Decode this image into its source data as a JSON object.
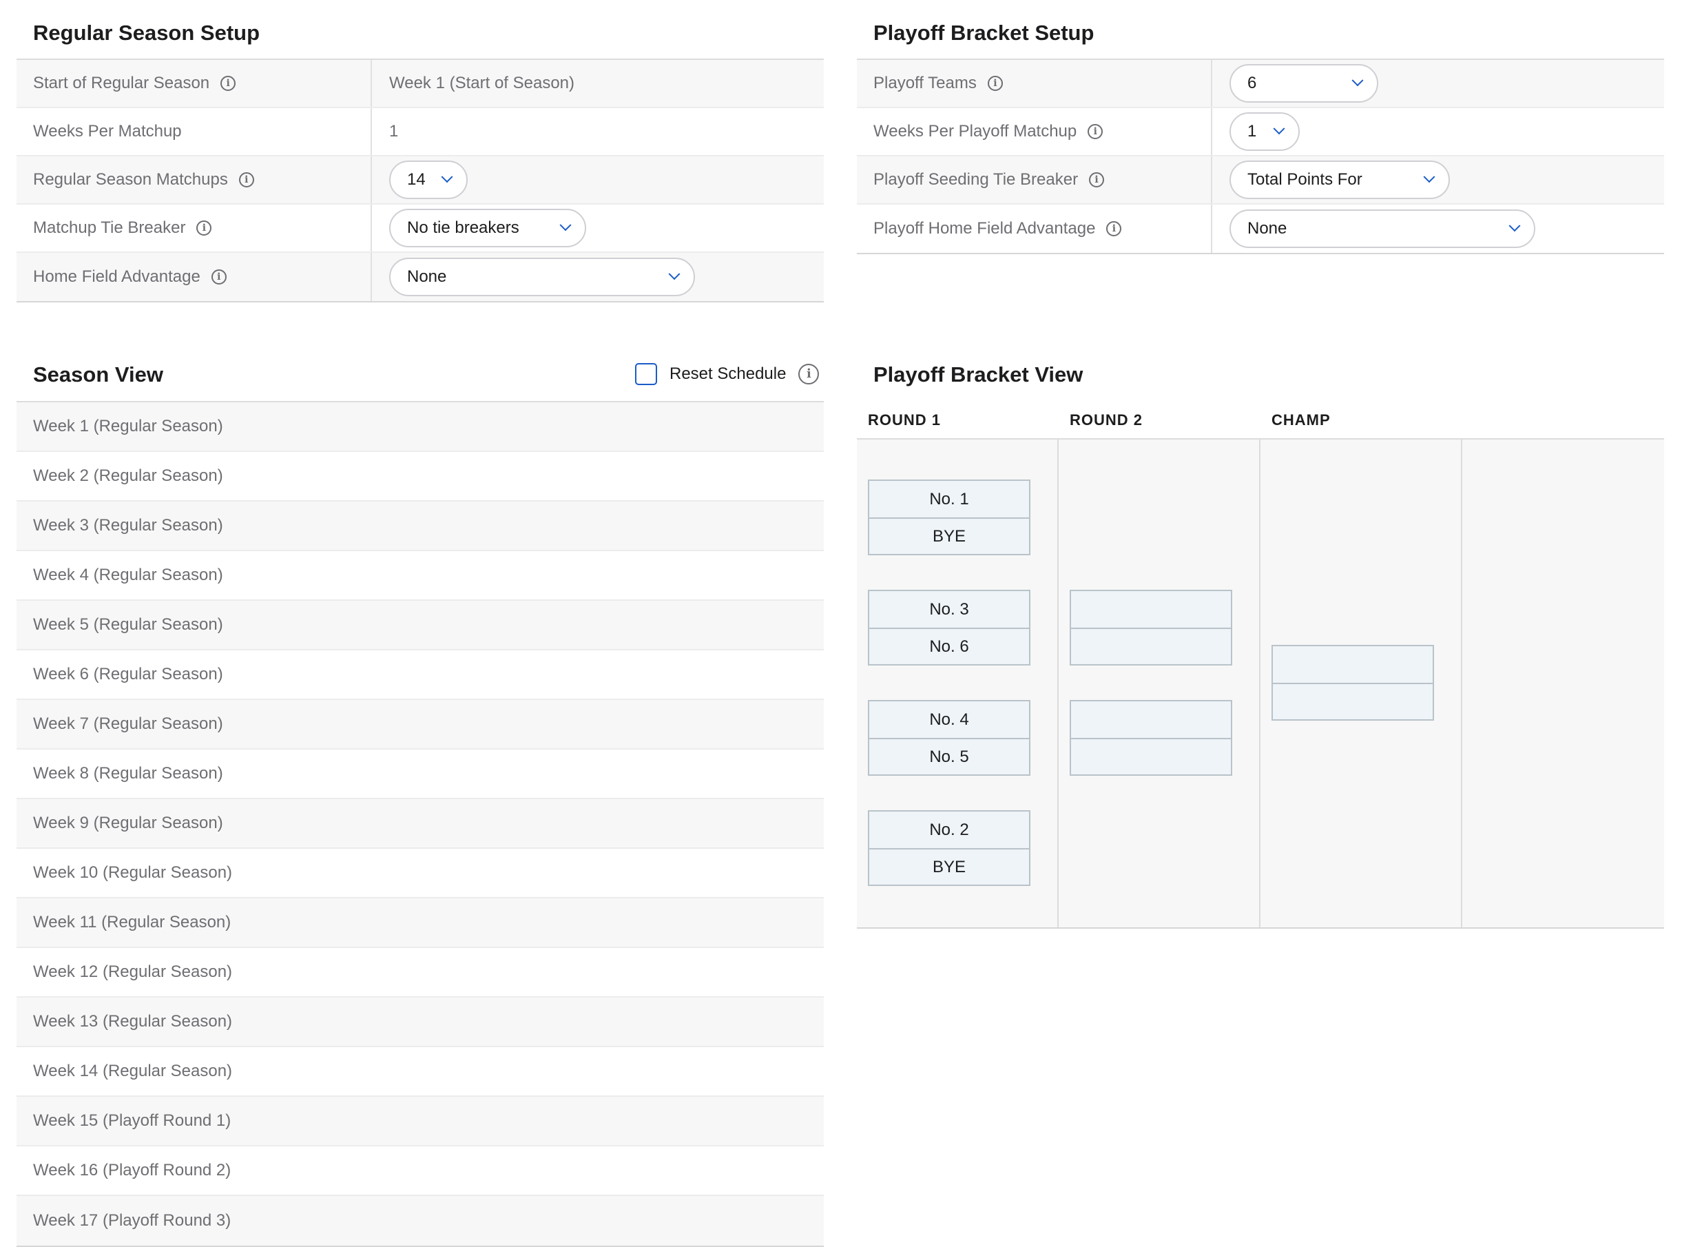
{
  "regular_setup": {
    "title": "Regular Season Setup",
    "rows": [
      {
        "label": "Start of Regular Season",
        "value": "Week 1 (Start of Season)"
      },
      {
        "label": "Weeks Per Matchup",
        "value": "1"
      },
      {
        "label": "Regular Season Matchups",
        "value": "14"
      },
      {
        "label": "Matchup Tie Breaker",
        "value": "No tie breakers"
      },
      {
        "label": "Home Field Advantage",
        "value": "None"
      }
    ]
  },
  "playoff_setup": {
    "title": "Playoff Bracket Setup",
    "rows": [
      {
        "label": "Playoff Teams",
        "value": "6"
      },
      {
        "label": "Weeks Per Playoff Matchup",
        "value": "1"
      },
      {
        "label": "Playoff Seeding Tie Breaker",
        "value": "Total Points For"
      },
      {
        "label": "Playoff Home Field Advantage",
        "value": "None"
      }
    ]
  },
  "season_view": {
    "title": "Season View",
    "reset_label": "Reset Schedule",
    "reset_checked": false,
    "weeks": [
      "Week 1 (Regular Season)",
      "Week 2 (Regular Season)",
      "Week 3 (Regular Season)",
      "Week 4 (Regular Season)",
      "Week 5 (Regular Season)",
      "Week 6 (Regular Season)",
      "Week 7 (Regular Season)",
      "Week 8 (Regular Season)",
      "Week 9 (Regular Season)",
      "Week 10 (Regular Season)",
      "Week 11 (Regular Season)",
      "Week 12 (Regular Season)",
      "Week 13 (Regular Season)",
      "Week 14 (Regular Season)",
      "Week 15 (Playoff Round 1)",
      "Week 16 (Playoff Round 2)",
      "Week 17 (Playoff Round 3)"
    ]
  },
  "bracket_view": {
    "title": "Playoff Bracket View",
    "round_headers": [
      "ROUND 1",
      "ROUND 2",
      "CHAMP"
    ],
    "round1": [
      [
        "No. 1",
        "BYE"
      ],
      [
        "No. 3",
        "No. 6"
      ],
      [
        "No. 4",
        "No. 5"
      ],
      [
        "No. 2",
        "BYE"
      ]
    ],
    "round2": [
      [
        "",
        ""
      ],
      [
        "",
        ""
      ]
    ],
    "champ": [
      [
        "",
        ""
      ]
    ]
  },
  "colors": {
    "accent": "#1a5cc8",
    "row_shade": "#f7f7f7",
    "match_fill": "#eef4f8",
    "match_border": "#b9c3c9"
  },
  "icons": [
    "info-icon",
    "chevron-down-icon",
    "checkbox"
  ]
}
